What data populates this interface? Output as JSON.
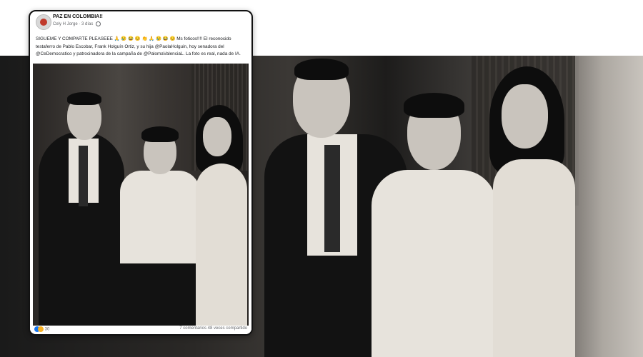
{
  "post": {
    "page_name": "PAZ EN COLOMBIA!!",
    "author": "Cely H Jorge",
    "time": "3 días",
    "text": "SIGUEME Y COMPARTE PLEASEEE 🙏 😢 😂 😊 👏 🙏 😢 😂 😊 Ms foticos!!!! El reconocido testaferro de Pablo Escobar, Frank Holguín Ortiz, y su hija @PaolaHolguin, hoy senadora del @CeDemocratico y patrocinadora de la campaña de @PalomaValenciaL. La foto es real, nada de IA.",
    "reaction_count": "30",
    "comments": "7 comentarios",
    "shares": "48 veces compartido"
  },
  "icons": {
    "avatar": "page-avatar",
    "globe": "public-globe-icon",
    "reactions": [
      "like-icon",
      "care-icon"
    ]
  },
  "colors": {
    "link": "#1877f2",
    "secondary_text": "#65676b",
    "card_border": "#111111"
  }
}
